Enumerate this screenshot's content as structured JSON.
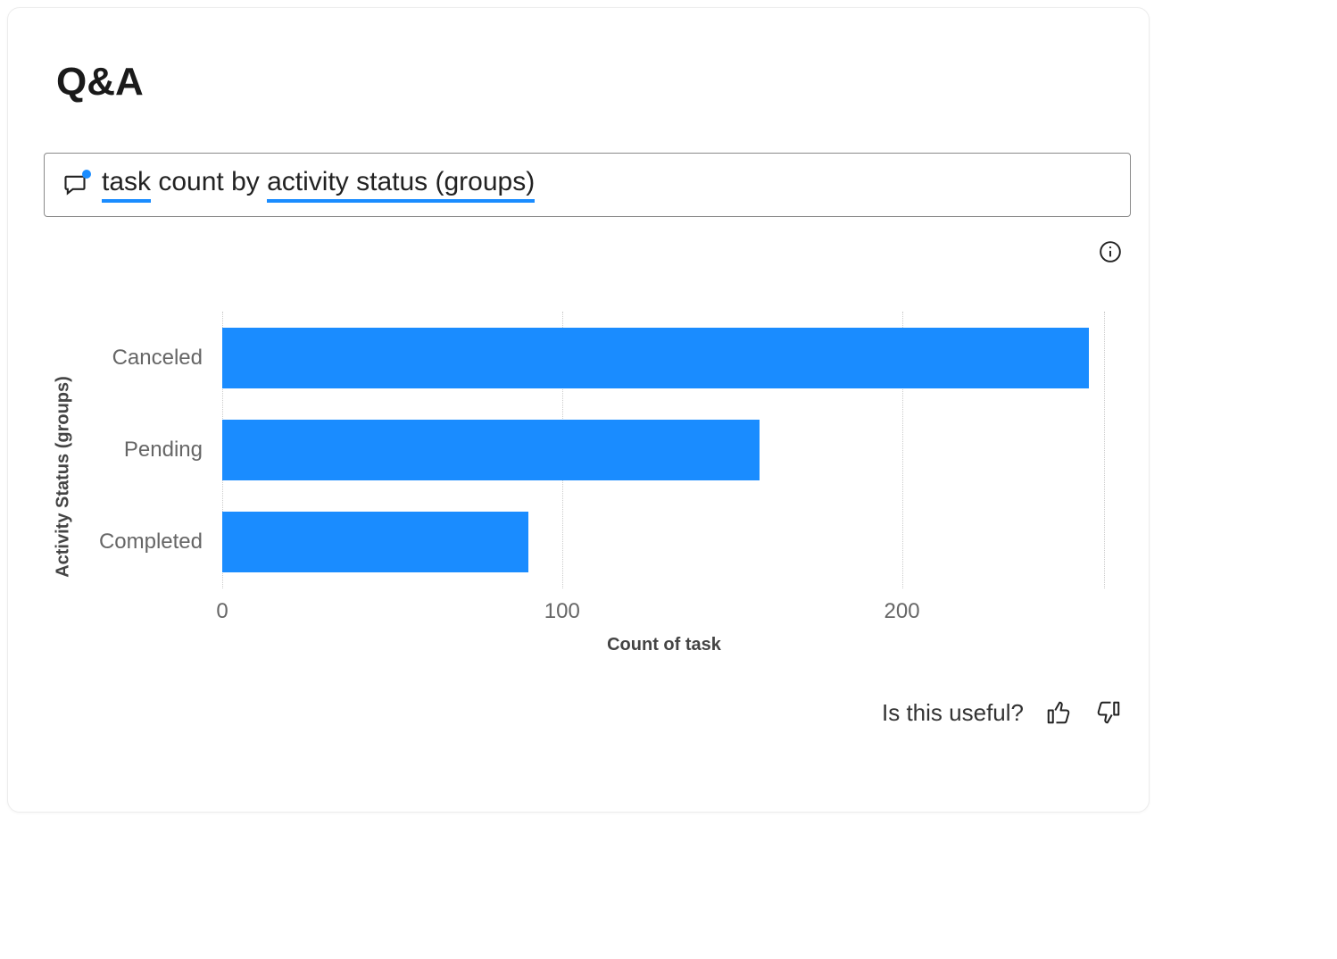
{
  "title": "Q&A",
  "query": {
    "tokens": [
      {
        "text": "task",
        "underlined": true
      },
      {
        "text": " count by ",
        "underlined": false
      },
      {
        "text": "activity status (groups)",
        "underlined": true
      }
    ]
  },
  "feedback": {
    "prompt": "Is this useful?"
  },
  "chart_data": {
    "type": "bar",
    "orientation": "horizontal",
    "categories": [
      "Canceled",
      "Pending",
      "Completed"
    ],
    "values": [
      255,
      158,
      90
    ],
    "xlabel": "Count of task",
    "ylabel": "Activity Status (groups)",
    "x_ticks": [
      0,
      100,
      200
    ],
    "xlim": [
      0,
      260
    ],
    "bar_color": "#1a8cff"
  }
}
